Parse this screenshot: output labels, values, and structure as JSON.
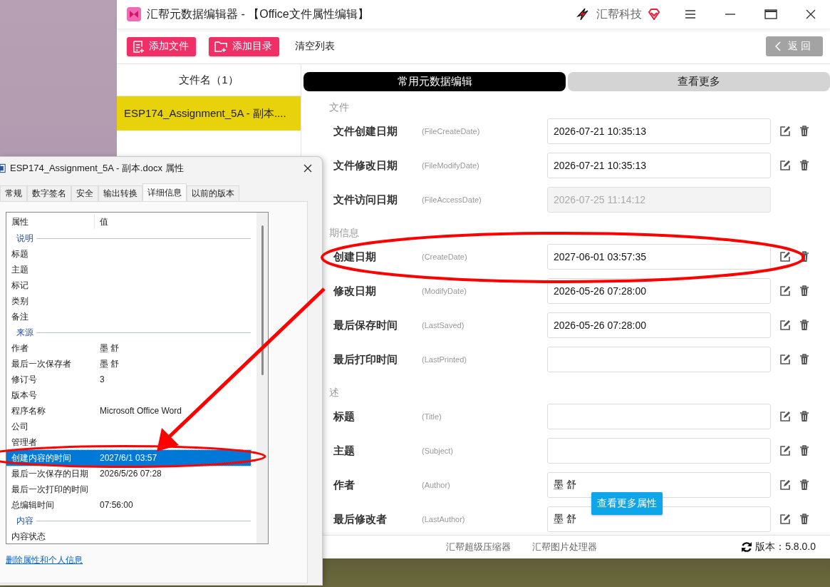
{
  "app": {
    "title": "汇帮元数据编辑器 - 【Office文件属性编辑】",
    "brand": "汇帮科技",
    "toolbar": {
      "buttons": [
        {
          "label": "添加文件",
          "kind": "file"
        },
        {
          "label": "添加目录",
          "kind": "folder"
        },
        {
          "label": "清空列表",
          "kind": "text"
        }
      ],
      "back": "返回"
    },
    "file_list": {
      "header": "文件名（1）",
      "items": [
        {
          "name": "ESP174_Assignment_5A - 副本....",
          "selected": true
        }
      ]
    },
    "tabs": [
      {
        "label": "常用元数据编辑",
        "selected": true
      },
      {
        "label": "查看更多",
        "selected": false
      }
    ],
    "sections": [
      {
        "title": "文件",
        "fields": [
          {
            "label": "文件创建日期",
            "tag": "(FileCreateDate)",
            "value": "2026-07-21 10:35:13",
            "disabled": false
          },
          {
            "label": "文件修改日期",
            "tag": "(FileModifyDate)",
            "value": "2026-07-21 10:35:13",
            "disabled": false
          },
          {
            "label": "文件访问日期",
            "tag": "(FileAccessDate)",
            "value": "2026-07-25 11:14:12",
            "disabled": true
          }
        ]
      },
      {
        "title": "期信息",
        "fields": [
          {
            "label": "创建日期",
            "tag": "(CreateDate)",
            "value": "2027-06-01 03:57:35",
            "disabled": false
          },
          {
            "label": "修改日期",
            "tag": "(ModifyDate)",
            "value": "2026-05-26 07:28:00",
            "disabled": false
          },
          {
            "label": "最后保存时间",
            "tag": "(LastSaved)",
            "value": "2026-05-26 07:28:00",
            "disabled": false
          },
          {
            "label": "最后打印时间",
            "tag": "(LastPrinted)",
            "disabled": false
          }
        ]
      },
      {
        "title": "述",
        "fields": [
          {
            "label": "标题",
            "tag": "(Title)",
            "disabled": false
          },
          {
            "label": "主题",
            "tag": "(Subject)",
            "disabled": false
          },
          {
            "label": "作者",
            "tag": "(Author)",
            "value": "墨 舒",
            "disabled": false
          },
          {
            "label": "最后修改者",
            "tag": "(LastAuthor)",
            "value": "墨 舒",
            "disabled": false
          }
        ]
      }
    ],
    "tooltip": "查看更多属性",
    "footer": {
      "links": [
        "汇帮超级压缩器",
        "汇帮图片处理器"
      ],
      "version": "版本：5.8.0.0"
    }
  },
  "dialog": {
    "title": "ESP174_Assignment_5A - 副本.docx 属性",
    "tabs": [
      {
        "label": "常规",
        "selected": false
      },
      {
        "label": "数字签名",
        "selected": false
      },
      {
        "label": "安全",
        "selected": false
      },
      {
        "label": "输出转换",
        "selected": false
      },
      {
        "label": "详细信息",
        "selected": true
      },
      {
        "label": "以前的版本",
        "selected": false
      }
    ],
    "columns": [
      "属性",
      "值"
    ],
    "rows": [
      {
        "kind": "group",
        "label": "说明"
      },
      {
        "kind": "property",
        "name": "标题",
        "selected": false
      },
      {
        "kind": "property",
        "name": "主题",
        "selected": false
      },
      {
        "kind": "property",
        "name": "标记",
        "selected": false
      },
      {
        "kind": "property",
        "name": "类别",
        "selected": false
      },
      {
        "kind": "property",
        "name": "备注",
        "selected": false
      },
      {
        "kind": "group",
        "label": "来源"
      },
      {
        "kind": "property",
        "name": "作者",
        "value": "墨 舒",
        "selected": false
      },
      {
        "kind": "property",
        "name": "最后一次保存者",
        "value": "墨 舒",
        "selected": false
      },
      {
        "kind": "property",
        "name": "修订号",
        "value": "3",
        "selected": false
      },
      {
        "kind": "property",
        "name": "版本号",
        "selected": false
      },
      {
        "kind": "property",
        "name": "程序名称",
        "value": "Microsoft Office Word",
        "selected": false
      },
      {
        "kind": "property",
        "name": "公司",
        "selected": false
      },
      {
        "kind": "property",
        "name": "管理者",
        "selected": false
      },
      {
        "kind": "property",
        "name": "创建内容的时间",
        "value": "2027/6/1 03:57",
        "selected": true
      },
      {
        "kind": "property",
        "name": "最后一次保存的日期",
        "value": "2026/5/26 07:28",
        "selected": false
      },
      {
        "kind": "property",
        "name": "最后一次打印的时间",
        "selected": false
      },
      {
        "kind": "property",
        "name": "总编辑时间",
        "value": "07:56:00",
        "selected": false
      },
      {
        "kind": "group",
        "label": "内容"
      },
      {
        "kind": "property",
        "name": "内容状态",
        "selected": false
      }
    ],
    "link": "删除属性和个人信息"
  }
}
